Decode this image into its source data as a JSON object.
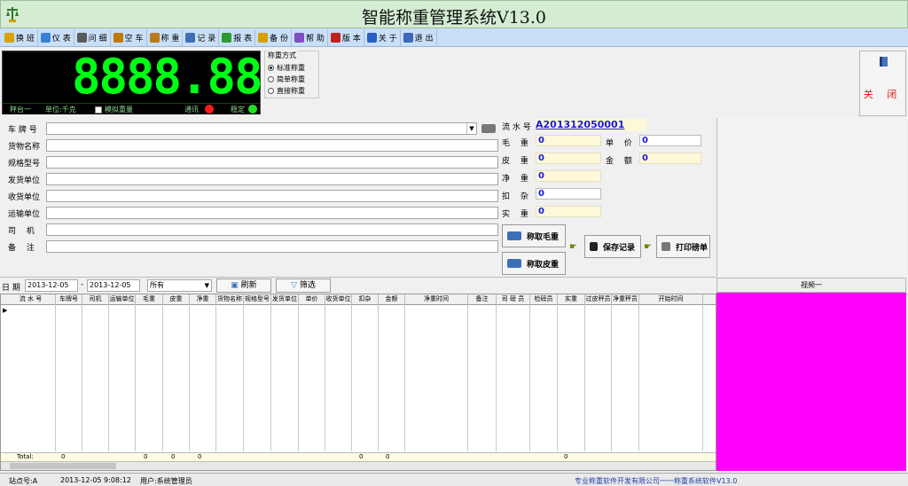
{
  "app": {
    "title": "智能称重管理系统V13.0"
  },
  "toolbar": [
    {
      "label": "换 班",
      "icon": "shift-icon",
      "color": "#d9a300"
    },
    {
      "label": "仪 表",
      "icon": "meter-icon",
      "color": "#3a7fd5"
    },
    {
      "label": "问 细",
      "icon": "edit-icon",
      "color": "#5a5a5a"
    },
    {
      "label": "空 车",
      "icon": "truck-icon",
      "color": "#c07a00"
    },
    {
      "label": "称 重",
      "icon": "scale-icon",
      "color": "#b87a20"
    },
    {
      "label": "记 录",
      "icon": "records-icon",
      "color": "#3c6fb5"
    },
    {
      "label": "报 表",
      "icon": "report-icon",
      "color": "#2e9a2e"
    },
    {
      "label": "备 份",
      "icon": "backup-icon",
      "color": "#d6a000"
    },
    {
      "label": "帮 助",
      "icon": "help-icon",
      "color": "#7d4fc0"
    },
    {
      "label": "版 本",
      "icon": "version-icon",
      "color": "#c02020"
    },
    {
      "label": "关 于",
      "icon": "about-icon",
      "color": "#2860c0"
    },
    {
      "label": "退 出",
      "icon": "exit-icon",
      "color": "#3c68b8"
    }
  ],
  "display": {
    "digits": "8888.88",
    "platform": "秤台一",
    "unit": "单位:千克",
    "simulate": "模拟重量",
    "comm": "通讯",
    "stable": "稳定",
    "comm_color": "#ff1a1a",
    "stable_color": "#22e022"
  },
  "mode": {
    "title": "称重方式",
    "options": [
      "标准称重",
      "简单称重",
      "直接称重"
    ],
    "selected": "标准称重"
  },
  "close_button": {
    "label": "关 闭"
  },
  "form": {
    "plate": "车 牌 号",
    "goods": "货物名称",
    "spec": "规格型号",
    "shipper": "发货单位",
    "receiver": "收货单位",
    "carrier": "运输单位",
    "driver": "司　 机",
    "remark": "备　 注"
  },
  "weigh": {
    "serial_label": "流 水 号",
    "serial": "A201312050001",
    "gross_label": "毛　 重",
    "gross": "0",
    "price_label": "单　 价",
    "price": "0",
    "tare_label": "皮　 重",
    "tare": "0",
    "amount_label": "金　 额",
    "amount": "0",
    "net_label": "净　 重",
    "net": "0",
    "deduct_label": "扣　 杂",
    "deduct": "0",
    "actual_label": "实　 重",
    "actual": "0"
  },
  "actions": {
    "gross_btn": "称取毛重",
    "tare_btn": "称取皮重",
    "save_btn": "保存记录",
    "print_btn": "打印磅单"
  },
  "filter": {
    "date_label": "日 期",
    "from": "2013-12-05",
    "to": "2013-12-05",
    "scope": "所有",
    "refresh": "刷新",
    "filter": "筛选"
  },
  "grid": {
    "columns": [
      "流 水 号",
      "车牌号",
      "司机",
      "运输单位",
      "毛重",
      "皮重",
      "净重",
      "货物名称",
      "规格型号",
      "发货单位",
      "单价",
      "收货单位",
      "扣杂",
      "金额",
      "净重时间",
      "备注",
      "司 磅 员",
      "检磅员",
      "实重",
      "过皮秤员",
      "净重秤员",
      "开始时间"
    ],
    "total_label": "Total:",
    "totals": [
      "0",
      "0",
      "0",
      "0",
      "0",
      "0",
      "0"
    ]
  },
  "video": {
    "title": "视频一",
    "color": "#ff00ff"
  },
  "status": {
    "site": "站点号:A",
    "time": "2013-12-05 9:08:12",
    "user": "用户:系统管理员",
    "company": "专业称重软件开发有限公司一一称重系统软件V13.0"
  }
}
